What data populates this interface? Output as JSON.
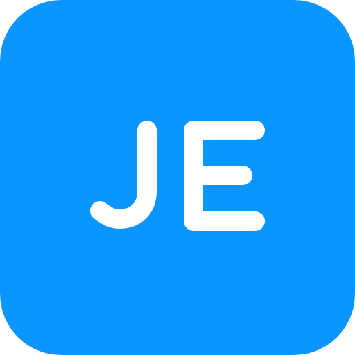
{
  "icon": {
    "name": "je-monogram-icon",
    "text": "JE",
    "background_color": "#0A95FF",
    "text_color": "#FFFFFF"
  }
}
